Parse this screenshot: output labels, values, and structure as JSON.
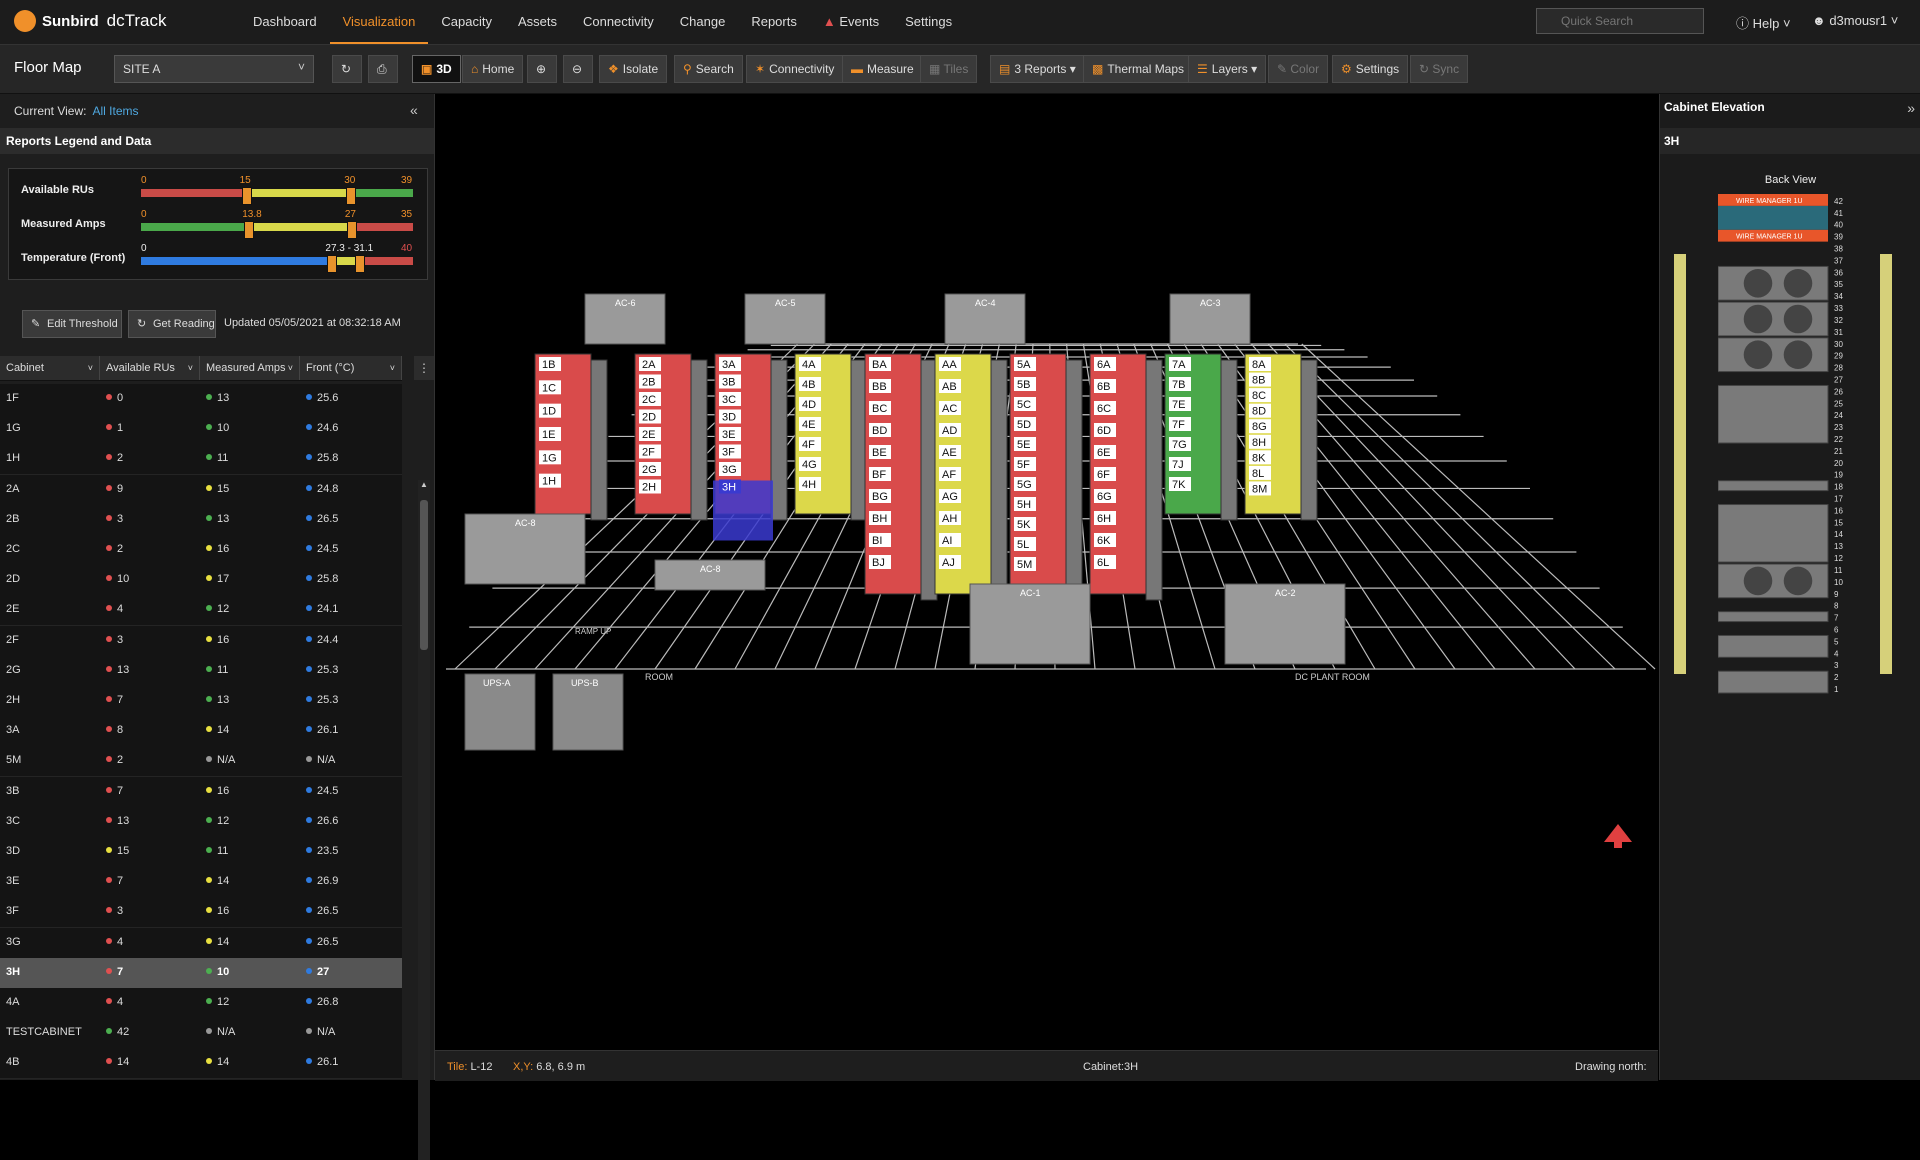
{
  "app": {
    "brand": "Sunbird",
    "product": "dcTrack"
  },
  "nav": {
    "items": [
      "Dashboard",
      "Visualization",
      "Capacity",
      "Assets",
      "Connectivity",
      "Change",
      "Reports",
      "Events",
      "Settings"
    ],
    "active": "Visualization"
  },
  "header": {
    "search_placeholder": "Quick Search",
    "help_label": "Help",
    "user_label": "d3mousr1"
  },
  "toolbar": {
    "title": "Floor Map",
    "site": "SITE A",
    "btn_3d": "3D",
    "home": "Home",
    "isolate": "Isolate",
    "search": "Search",
    "connectivity": "Connectivity",
    "measure": "Measure",
    "tiles": "Tiles",
    "reports": "3 Reports",
    "thermal": "Thermal Maps",
    "layers": "Layers",
    "color": "Color",
    "settings": "Settings",
    "sync": "Sync"
  },
  "left": {
    "current_view_label": "Current View:",
    "current_view_value": "All Items",
    "legend_title": "Reports Legend and Data",
    "legend": [
      {
        "label": "Available RUs",
        "min": "0",
        "t1": "15",
        "t2": "30",
        "max": "39",
        "colors": [
          "#c94b47",
          "#d8d84a",
          "#4aa84a"
        ]
      },
      {
        "label": "Measured Amps",
        "min": "0",
        "t1": "13.8",
        "t2": "27",
        "max": "35",
        "colors": [
          "#4aa84a",
          "#d8d84a",
          "#c94b47"
        ]
      },
      {
        "label": "Temperature (Front)",
        "min": "0",
        "t1": "27.3 - 31.1",
        "t2": "",
        "max": "40",
        "colors": [
          "#2f7be0",
          "#d8d84a",
          "#c94b47"
        ]
      }
    ],
    "edit_threshold": "Edit Threshold",
    "get_reading": "Get Reading",
    "updated": "Updated 05/05/2021 at 08:32:18 AM",
    "columns": [
      "Cabinet",
      "Available RUs",
      "Measured Amps",
      "Front (°C)"
    ],
    "rows": [
      {
        "cab": "1F",
        "ru": "0",
        "ruc": "#e05050",
        "amps": "13",
        "ampc": "#4caf50",
        "temp": "25.6",
        "tc": "#2f7be0"
      },
      {
        "cab": "1G",
        "ru": "1",
        "ruc": "#e05050",
        "amps": "10",
        "ampc": "#4caf50",
        "temp": "24.6",
        "tc": "#2f7be0"
      },
      {
        "cab": "1H",
        "ru": "2",
        "ruc": "#e05050",
        "amps": "11",
        "ampc": "#4caf50",
        "temp": "25.8",
        "tc": "#2f7be0"
      },
      {
        "cab": "2A",
        "ru": "9",
        "ruc": "#e05050",
        "amps": "15",
        "ampc": "#e8e040",
        "temp": "24.8",
        "tc": "#2f7be0"
      },
      {
        "cab": "2B",
        "ru": "3",
        "ruc": "#e05050",
        "amps": "13",
        "ampc": "#4caf50",
        "temp": "26.5",
        "tc": "#2f7be0"
      },
      {
        "cab": "2C",
        "ru": "2",
        "ruc": "#e05050",
        "amps": "16",
        "ampc": "#e8e040",
        "temp": "24.5",
        "tc": "#2f7be0"
      },
      {
        "cab": "2D",
        "ru": "10",
        "ruc": "#e05050",
        "amps": "17",
        "ampc": "#e8e040",
        "temp": "25.8",
        "tc": "#2f7be0"
      },
      {
        "cab": "2E",
        "ru": "4",
        "ruc": "#e05050",
        "amps": "12",
        "ampc": "#4caf50",
        "temp": "24.1",
        "tc": "#2f7be0"
      },
      {
        "cab": "2F",
        "ru": "3",
        "ruc": "#e05050",
        "amps": "16",
        "ampc": "#e8e040",
        "temp": "24.4",
        "tc": "#2f7be0"
      },
      {
        "cab": "2G",
        "ru": "13",
        "ruc": "#e05050",
        "amps": "11",
        "ampc": "#4caf50",
        "temp": "25.3",
        "tc": "#2f7be0"
      },
      {
        "cab": "2H",
        "ru": "7",
        "ruc": "#e05050",
        "amps": "13",
        "ampc": "#4caf50",
        "temp": "25.3",
        "tc": "#2f7be0"
      },
      {
        "cab": "3A",
        "ru": "8",
        "ruc": "#e05050",
        "amps": "14",
        "ampc": "#e8e040",
        "temp": "26.1",
        "tc": "#2f7be0"
      },
      {
        "cab": "5M",
        "ru": "2",
        "ruc": "#e05050",
        "amps": "N/A",
        "ampc": "#999999",
        "temp": "N/A",
        "tc": "#999999"
      },
      {
        "cab": "3B",
        "ru": "7",
        "ruc": "#e05050",
        "amps": "16",
        "ampc": "#e8e040",
        "temp": "24.5",
        "tc": "#2f7be0"
      },
      {
        "cab": "3C",
        "ru": "13",
        "ruc": "#e05050",
        "amps": "12",
        "ampc": "#4caf50",
        "temp": "26.6",
        "tc": "#2f7be0"
      },
      {
        "cab": "3D",
        "ru": "15",
        "ruc": "#e8e040",
        "amps": "11",
        "ampc": "#4caf50",
        "temp": "23.5",
        "tc": "#2f7be0"
      },
      {
        "cab": "3E",
        "ru": "7",
        "ruc": "#e05050",
        "amps": "14",
        "ampc": "#e8e040",
        "temp": "26.9",
        "tc": "#2f7be0"
      },
      {
        "cab": "3F",
        "ru": "3",
        "ruc": "#e05050",
        "amps": "16",
        "ampc": "#e8e040",
        "temp": "26.5",
        "tc": "#2f7be0"
      },
      {
        "cab": "3G",
        "ru": "4",
        "ruc": "#e05050",
        "amps": "14",
        "ampc": "#e8e040",
        "temp": "26.5",
        "tc": "#2f7be0"
      },
      {
        "cab": "3H",
        "ru": "7",
        "ruc": "#e05050",
        "amps": "10",
        "ampc": "#4caf50",
        "temp": "27",
        "tc": "#2f7be0",
        "selected": true
      },
      {
        "cab": "4A",
        "ru": "4",
        "ruc": "#e05050",
        "amps": "12",
        "ampc": "#4caf50",
        "temp": "26.8",
        "tc": "#2f7be0"
      },
      {
        "cab": "TESTCABINET",
        "ru": "42",
        "ruc": "#4caf50",
        "amps": "N/A",
        "ampc": "#999999",
        "temp": "N/A",
        "tc": "#999999"
      },
      {
        "cab": "4B",
        "ru": "14",
        "ruc": "#e05050",
        "amps": "14",
        "ampc": "#e8e040",
        "temp": "26.1",
        "tc": "#2f7be0"
      }
    ]
  },
  "floor": {
    "rows": [
      {
        "labels": [
          "1B",
          "1C",
          "1D",
          "1E",
          "1G",
          "1H"
        ],
        "color": "#d94b4b"
      },
      {
        "labels": [
          "2A",
          "2B",
          "2C",
          "2D",
          "2E",
          "2F",
          "2G",
          "2H"
        ],
        "color": "#d94b4b"
      },
      {
        "labels": [
          "3A",
          "3B",
          "3C",
          "3D",
          "3E",
          "3F",
          "3G",
          "3H"
        ],
        "color": "#d94b4b"
      },
      {
        "labels": [
          "4A",
          "4B",
          "4D",
          "4E",
          "4F",
          "4G",
          "4H"
        ],
        "color": "#dcd84a"
      },
      {
        "labels": [
          "BA",
          "BB",
          "BC",
          "BD",
          "BE",
          "BF",
          "BG",
          "BH",
          "BI",
          "BJ"
        ],
        "color": "#d94b4b"
      },
      {
        "labels": [
          "AA",
          "AB",
          "AC",
          "AD",
          "AE",
          "AF",
          "AG",
          "AH",
          "AI",
          "AJ"
        ],
        "color": "#dcd84a"
      },
      {
        "labels": [
          "5A",
          "5B",
          "5C",
          "5D",
          "5E",
          "5F",
          "5G",
          "5H",
          "5K",
          "5L",
          "5M"
        ],
        "color": "#d94b4b"
      },
      {
        "labels": [
          "6A",
          "6B",
          "6C",
          "6D",
          "6E",
          "6F",
          "6G",
          "6H",
          "6K",
          "6L"
        ],
        "color": "#d94b4b"
      },
      {
        "labels": [
          "7A",
          "7B",
          "7E",
          "7F",
          "7G",
          "7J",
          "7K"
        ],
        "color": "#4aa84a"
      },
      {
        "labels": [
          "8A",
          "8B",
          "8C",
          "8D",
          "8G",
          "8H",
          "8K",
          "8L",
          "8M"
        ],
        "color": "#dcd84a"
      }
    ],
    "ac_units": [
      "AC-6",
      "AC-5",
      "AC-4",
      "AC-3",
      "AC-8",
      "AC-8",
      "AC-1",
      "AC-2"
    ],
    "ups": [
      "UPS-A",
      "UPS-B"
    ],
    "room_labels": [
      "ROOM",
      "DC PLANT ROOM"
    ],
    "ramp_label": "RAMP UP"
  },
  "status": {
    "tile_label": "Tile:",
    "tile_value": "L-12",
    "xy_label": "X,Y:",
    "xy_value": "6.8, 6.9 m",
    "cabinet": "Cabinet:3H",
    "drawing_north": "Drawing north:"
  },
  "elevation": {
    "title": "Cabinet Elevation",
    "cabinet": "3H",
    "view": "Back View",
    "wire_manager_label": "WIRE MANAGER 1U",
    "ru_count": 42
  }
}
